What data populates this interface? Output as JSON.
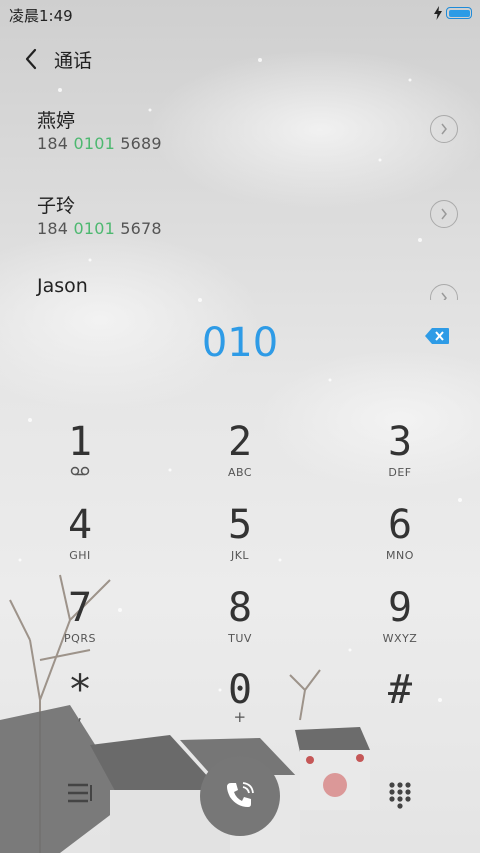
{
  "status_bar": {
    "time": "凌晨1:49",
    "battery_level": 1.0,
    "charging": true
  },
  "header": {
    "title": "通话"
  },
  "contacts": [
    {
      "name": "燕婷",
      "number_prefix": "184 ",
      "number_match": "0101",
      "number_suffix": " 5689"
    },
    {
      "name": "子玲",
      "number_prefix": "184 ",
      "number_match": "0101",
      "number_suffix": " 5678"
    },
    {
      "name": "Jason"
    }
  ],
  "dialer": {
    "input_value": "010",
    "keys": [
      {
        "digit": "1",
        "letters": ""
      },
      {
        "digit": "2",
        "letters": "ABC"
      },
      {
        "digit": "3",
        "letters": "DEF"
      },
      {
        "digit": "4",
        "letters": "GHI"
      },
      {
        "digit": "5",
        "letters": "JKL"
      },
      {
        "digit": "6",
        "letters": "MNO"
      },
      {
        "digit": "7",
        "letters": "PQRS"
      },
      {
        "digit": "8",
        "letters": "TUV"
      },
      {
        "digit": "9",
        "letters": "WXYZ"
      },
      {
        "digit": "*",
        "letters": ","
      },
      {
        "digit": "0",
        "letters": "+"
      },
      {
        "digit": "#",
        "letters": ""
      }
    ]
  },
  "colors": {
    "accent": "#2e9be6",
    "match_highlight": "#4db870",
    "call_button": "#777777"
  },
  "icons": {
    "back": "chevron-left-icon",
    "delete": "backspace-icon",
    "menu": "menu-icon",
    "call": "phone-icon",
    "keypad": "dialpad-icon",
    "voicemail": "voicemail-icon"
  }
}
